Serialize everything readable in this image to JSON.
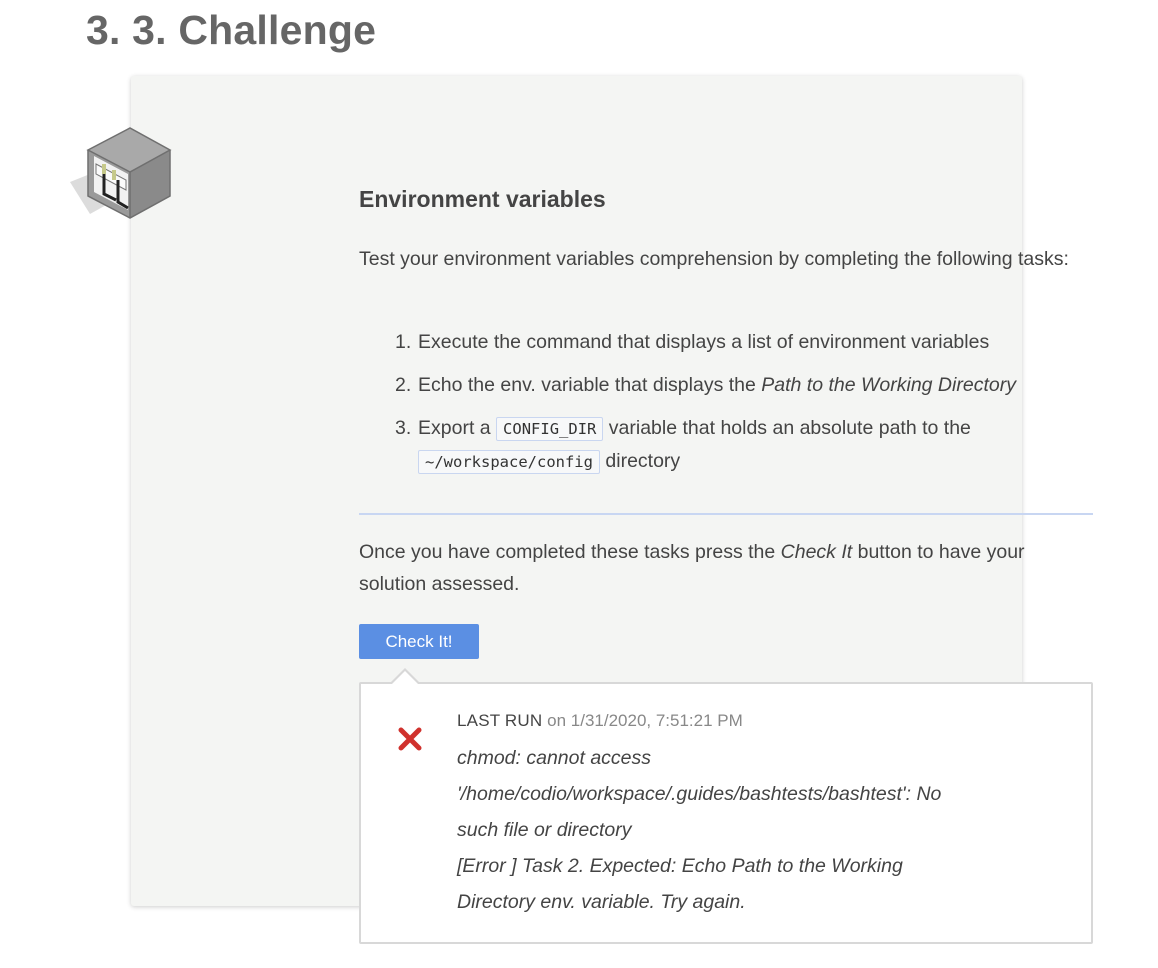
{
  "section": {
    "title": "3. 3. Challenge"
  },
  "card": {
    "title": "Environment variables",
    "icon": "cube-challenge-icon",
    "intro": "Test your environment variables comprehension by completing the following tasks:",
    "tasks": [
      {
        "number": "1.",
        "text": "Execute the command that displays a list of environment variables"
      },
      {
        "number": "2.",
        "text_before": "Echo the env. variable that displays the ",
        "emphasis": "Path to the Working Directory"
      },
      {
        "number": "3.",
        "text_before": "Export a ",
        "code1": "CONFIG_DIR",
        "text_middle": " variable that holds an absolute path to the ",
        "code2": "~/workspace/config",
        "text_after": " directory"
      }
    ],
    "instruction": {
      "before": "Once you have completed these tasks press the ",
      "emphasis": "Check It",
      "after": " button to have your solution assessed."
    },
    "check_button_label": "Check It!",
    "accent_color": "#5b8fe3"
  },
  "result": {
    "status": "fail",
    "status_icon": "red-x-icon",
    "status_color": "#d0312d",
    "label": "LAST RUN",
    "on": "on",
    "date": "1/31/2020, 7:51:21 PM",
    "lines": [
      "chmod: cannot access",
      "'/home/codio/workspace/.guides/bashtests/bashtest': No",
      "such file or directory",
      "[Error  ] Task 2. Expected: Echo Path to the Working",
      "Directory env. variable. Try again."
    ]
  }
}
